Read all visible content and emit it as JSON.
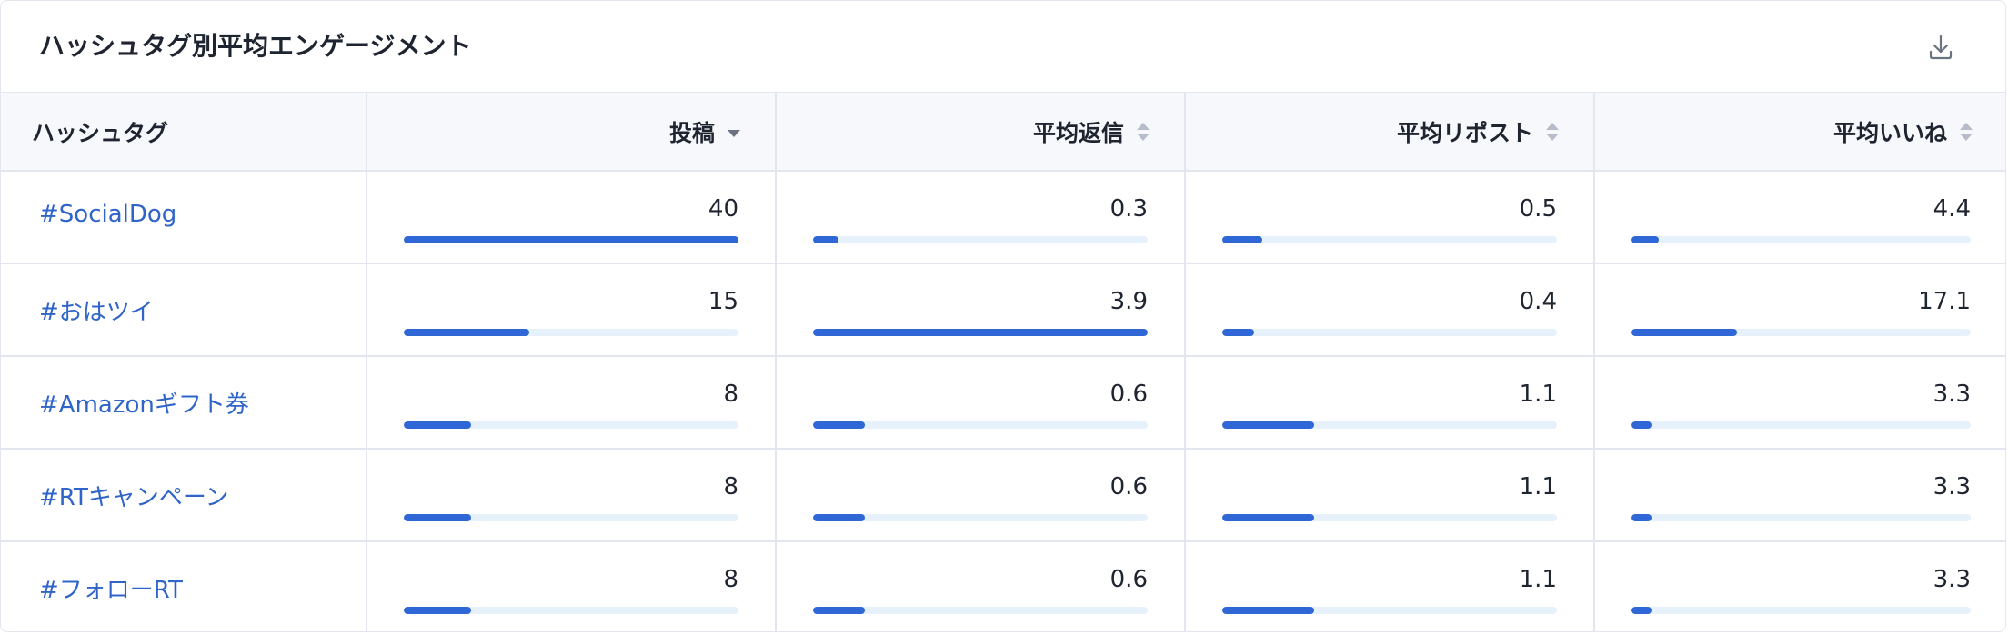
{
  "card": {
    "title": "ハッシュタグ別平均エンゲージメント",
    "download_icon": "download-icon"
  },
  "columns": [
    {
      "label": "ハッシュタグ",
      "sort": "none-icon"
    },
    {
      "label": "投稿",
      "sort": "sort-desc-icon"
    },
    {
      "label": "平均返信",
      "sort": "sort-both-icon"
    },
    {
      "label": "平均リポスト",
      "sort": "sort-both-icon"
    },
    {
      "label": "平均いいね",
      "sort": "sort-both-icon"
    }
  ],
  "rows": [
    {
      "hashtag": "#SocialDog",
      "posts": "40",
      "avg_replies": "0.3",
      "avg_reposts": "0.5",
      "avg_likes": "4.4",
      "fill": {
        "posts": 1.0,
        "avg_replies": 0.077,
        "avg_reposts": 0.12,
        "avg_likes": 0.08
      }
    },
    {
      "hashtag": "#おはツイ",
      "posts": "15",
      "avg_replies": "3.9",
      "avg_reposts": "0.4",
      "avg_likes": "17.1",
      "fill": {
        "posts": 0.375,
        "avg_replies": 1.0,
        "avg_reposts": 0.095,
        "avg_likes": 0.31
      }
    },
    {
      "hashtag": "#Amazonギフト券",
      "posts": "8",
      "avg_replies": "0.6",
      "avg_reposts": "1.1",
      "avg_likes": "3.3",
      "fill": {
        "posts": 0.2,
        "avg_replies": 0.154,
        "avg_reposts": 0.275,
        "avg_likes": 0.06
      }
    },
    {
      "hashtag": "#RTキャンペーン",
      "posts": "8",
      "avg_replies": "0.6",
      "avg_reposts": "1.1",
      "avg_likes": "3.3",
      "fill": {
        "posts": 0.2,
        "avg_replies": 0.154,
        "avg_reposts": 0.275,
        "avg_likes": 0.06
      }
    },
    {
      "hashtag": "#フォローRT",
      "posts": "8",
      "avg_replies": "0.6",
      "avg_reposts": "1.1",
      "avg_likes": "3.3",
      "fill": {
        "posts": 0.2,
        "avg_replies": 0.154,
        "avg_reposts": 0.275,
        "avg_likes": 0.06
      }
    }
  ],
  "colors": {
    "accent": "#2f68d6",
    "link": "#2f64c8",
    "track": "#e6f1fb",
    "border": "#e3e6ee",
    "header_bg": "#f7f8fb"
  }
}
